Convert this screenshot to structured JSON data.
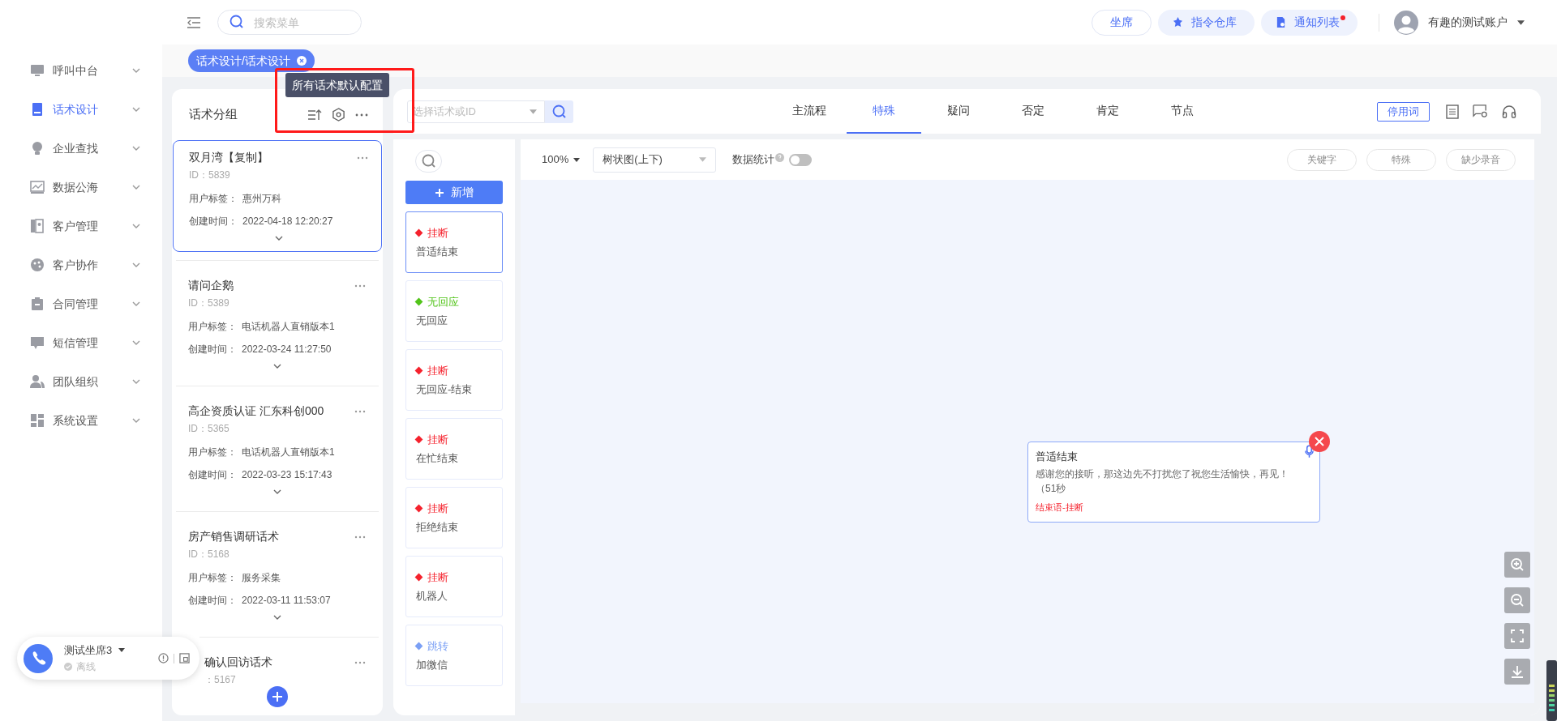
{
  "sidebar": {
    "items": [
      {
        "label": "呼叫中台",
        "selected": false
      },
      {
        "label": "话术设计",
        "selected": true
      },
      {
        "label": "企业查找",
        "selected": false
      },
      {
        "label": "数据公海",
        "selected": false
      },
      {
        "label": "客户管理",
        "selected": false
      },
      {
        "label": "客户协作",
        "selected": false
      },
      {
        "label": "合同管理",
        "selected": false
      },
      {
        "label": "短信管理",
        "selected": false
      },
      {
        "label": "团队组织",
        "selected": false
      },
      {
        "label": "系统设置",
        "selected": false
      }
    ]
  },
  "topbar": {
    "search": {
      "placeholder": "搜索菜单"
    },
    "buttons": [
      {
        "label": "坐席",
        "kind": "outline",
        "badge": false
      },
      {
        "label": "指令仓库",
        "kind": "command",
        "badge": false
      },
      {
        "label": "通知列表",
        "kind": "notice",
        "badge": true
      }
    ],
    "user": {
      "name": "有趣的测试账户"
    }
  },
  "page_tabs": [
    {
      "label": "话术设计/话术设计",
      "selected": true
    }
  ],
  "script_groups": {
    "title": "话术分组",
    "tooltip": "所有话术默认配置",
    "cards": [
      {
        "title": "双月湾【复制】",
        "id": "ID：5839",
        "tag_label": "用户标签：",
        "tag": "惠州万科",
        "time_label": "创建时间：",
        "time": "2022-04-18 12:20:27",
        "selected": true,
        "partial": false
      },
      {
        "title": "请问企鹅",
        "id": "ID：5389",
        "tag_label": "用户标签：",
        "tag": "电话机器人直销版本1",
        "time_label": "创建时间：",
        "time": "2022-03-24 11:27:50",
        "selected": false,
        "partial": false
      },
      {
        "title": "高企资质认证 汇东科创000",
        "id": "ID：5365",
        "tag_label": "用户标签：",
        "tag": "电话机器人直销版本1",
        "time_label": "创建时间：",
        "time": "2022-03-23 15:17:43",
        "selected": false,
        "partial": false
      },
      {
        "title": "房产销售调研话术",
        "id": "ID：5168",
        "tag_label": "用户标签：",
        "tag": "服务采集",
        "time_label": "创建时间：",
        "time": "2022-03-11 11:53:07",
        "selected": false,
        "partial": false
      },
      {
        "title": "确认回访话术",
        "id": "：5167",
        "selected": false,
        "partial": true
      }
    ]
  },
  "editor": {
    "script_select": {
      "placeholder": "选择话术或ID"
    },
    "tabs": [
      {
        "label": "主流程",
        "selected": false
      },
      {
        "label": "特殊",
        "selected": true
      },
      {
        "label": "疑问",
        "selected": false
      },
      {
        "label": "否定",
        "selected": false
      },
      {
        "label": "肯定",
        "selected": false
      },
      {
        "label": "节点",
        "selected": false
      }
    ],
    "stopwords_button": "停用词",
    "nodes_panel": {
      "add_button": "新增",
      "nodes": [
        {
          "type": "挂断",
          "color": "#f5222d",
          "name": "普适结束",
          "selected": true
        },
        {
          "type": "无回应",
          "color": "#52c41a",
          "name": "无回应",
          "selected": false
        },
        {
          "type": "挂断",
          "color": "#f5222d",
          "name": "无回应-结束",
          "selected": false
        },
        {
          "type": "挂断",
          "color": "#f5222d",
          "name": "在忙结束",
          "selected": false
        },
        {
          "type": "挂断",
          "color": "#f5222d",
          "name": "拒绝结束",
          "selected": false
        },
        {
          "type": "挂断",
          "color": "#f5222d",
          "name": "机器人",
          "selected": false
        },
        {
          "type": "跳转",
          "color": "#7ba0f5",
          "name": "加微信",
          "selected": false
        }
      ]
    },
    "toolbar": {
      "zoom": "100%",
      "layout": "树状图(上下)",
      "stats_label": "数据统计",
      "stats_on": false,
      "filters": [
        "关键字",
        "特殊",
        "缺少录音"
      ]
    },
    "canvas_node": {
      "title": "普适结束",
      "text": "感谢您的接听，那这边先不打扰您了祝您生活愉快，再见！（51秒",
      "tag": "结束语-挂断"
    }
  },
  "phone_widget": {
    "name": "测试坐席3",
    "status": "离线"
  }
}
